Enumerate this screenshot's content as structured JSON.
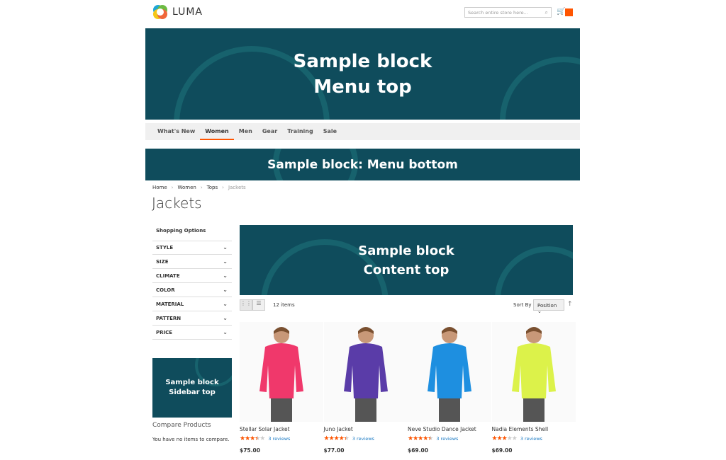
{
  "header": {
    "logo_text": "LUMA",
    "search_placeholder": "Search entire store here...",
    "accent": "#ff5501"
  },
  "banners": {
    "menu_top": [
      "Sample block",
      "Menu top"
    ],
    "menu_bottom": "Sample block: Menu bottom",
    "content_top": [
      "Sample block",
      "Content top"
    ],
    "sidebar_top": [
      "Sample block",
      "Sidebar top"
    ]
  },
  "nav": [
    "What's New",
    "Women",
    "Men",
    "Gear",
    "Training",
    "Sale"
  ],
  "nav_active": "Women",
  "breadcrumb": [
    "Home",
    "Women",
    "Tops",
    "Jackets"
  ],
  "page_title": "Jackets",
  "sidebar": {
    "title": "Shopping Options",
    "filters": [
      "STYLE",
      "SIZE",
      "CLIMATE",
      "COLOR",
      "MATERIAL",
      "PATTERN",
      "PRICE"
    ],
    "compare_title": "Compare Products",
    "compare_text": "You have no items to compare."
  },
  "toolbar": {
    "count": "12 items",
    "sort_label": "Sort By",
    "sort_value": "Position"
  },
  "products": [
    {
      "name": "Stellar Solar Jacket",
      "rating": 3.5,
      "reviews": "3 reviews",
      "price": "$75.00",
      "color": "#f0386b"
    },
    {
      "name": "Juno Jacket",
      "rating": 4.5,
      "reviews": "3 reviews",
      "price": "$77.00",
      "color": "#5a3ca8"
    },
    {
      "name": "Neve Studio Dance Jacket",
      "rating": 4.5,
      "reviews": "3 reviews",
      "price": "$69.00",
      "color": "#1e8fe0"
    },
    {
      "name": "Nadia Elements Shell",
      "rating": 3,
      "reviews": "3 reviews",
      "price": "$69.00",
      "color": "#dcf24a"
    }
  ]
}
